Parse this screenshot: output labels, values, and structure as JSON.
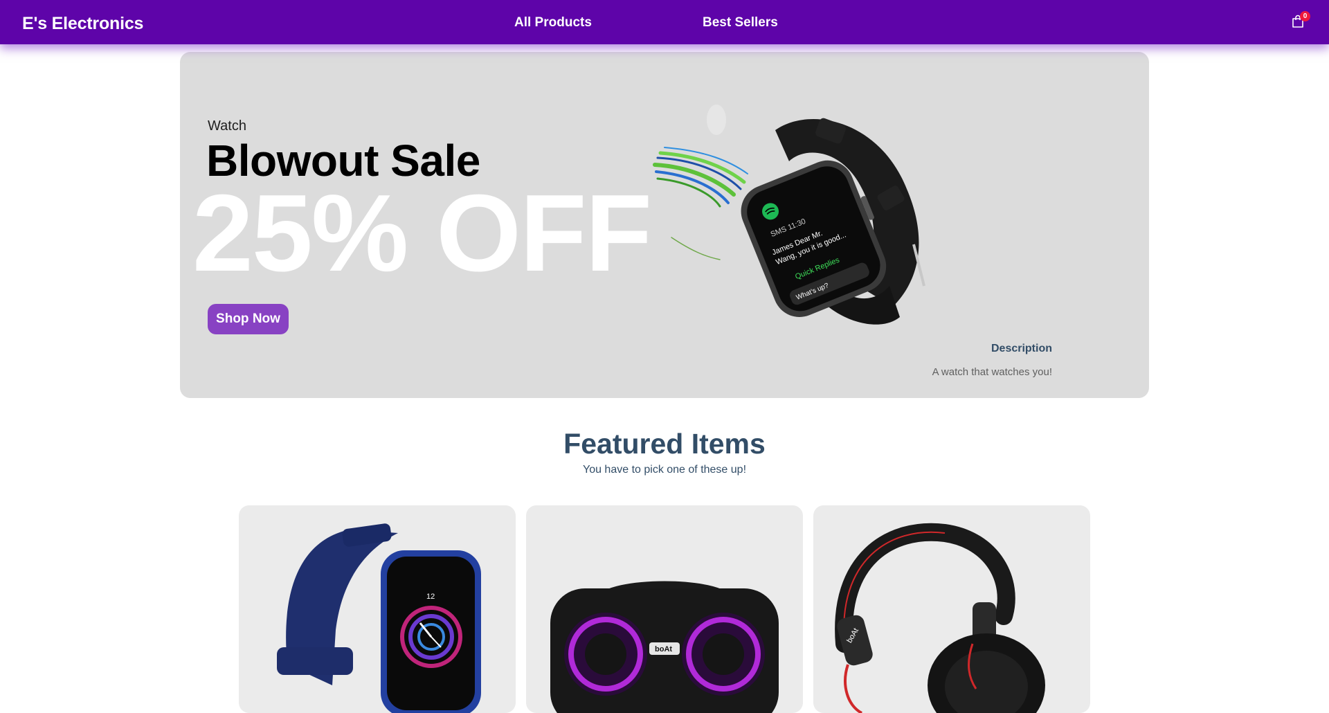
{
  "navbar": {
    "brand": "E's Electronics",
    "links": [
      {
        "label": "All Products"
      },
      {
        "label": "Best Sellers"
      }
    ],
    "cart": {
      "icon": "shopping-bag-icon",
      "count": "0"
    },
    "color": "#5e04a9"
  },
  "hero": {
    "small_text": "Watch",
    "mid_text": "Blowout Sale",
    "large_text": "25% OFF",
    "button_label": "Shop Now",
    "description_title": "Description",
    "description": "A watch that watches you!",
    "background": "#dcdcdc",
    "button_color": "#8842c3",
    "watch_screen": {
      "time": "SMS 11:30",
      "message_line1": "James Dear Mr.",
      "message_line2": "Wang, you it is good...",
      "quick_replies": "Quick Replies",
      "prompt": "What's up?"
    }
  },
  "featured": {
    "title": "Featured Items",
    "subtitle": "You have to pick one of these up!",
    "products": [
      {
        "image": "smartwatch-blue",
        "watch_time": "12"
      },
      {
        "image": "speaker-boat",
        "brand_mark": "boAt"
      },
      {
        "image": "headphones-black",
        "brand_mark": "boAt"
      }
    ]
  }
}
